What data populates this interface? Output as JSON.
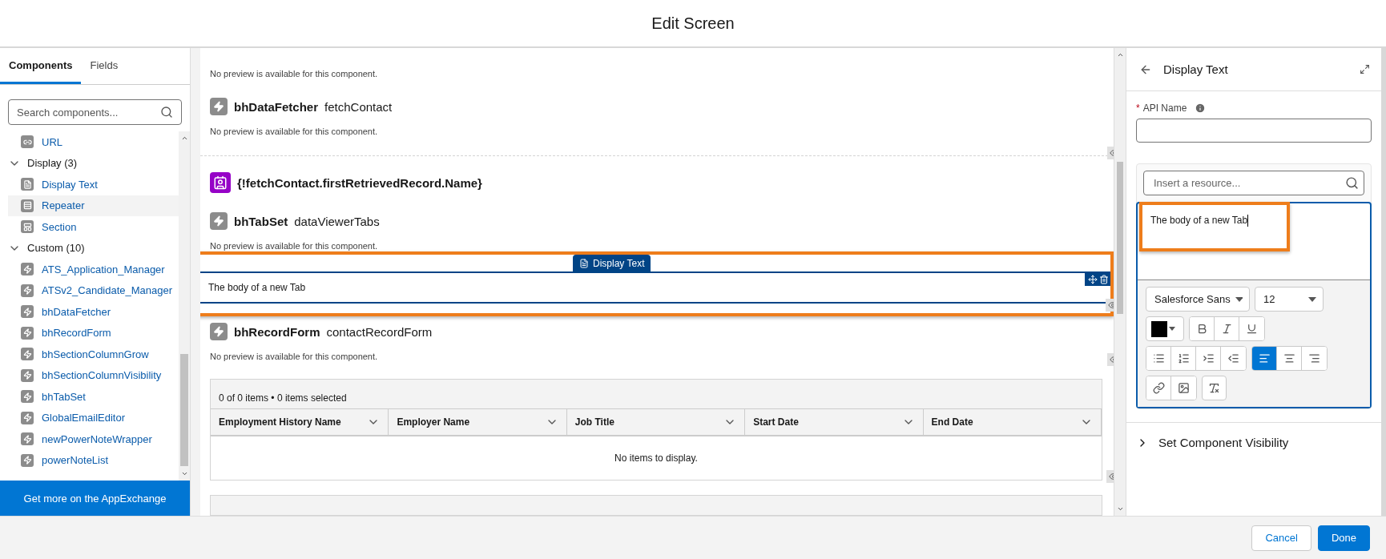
{
  "dialog": {
    "title": "Edit Screen"
  },
  "left_panel": {
    "tabs": [
      {
        "label": "Components",
        "selected": true
      },
      {
        "label": "Fields",
        "selected": false
      }
    ],
    "search": {
      "placeholder": "Search components..."
    },
    "items": [
      {
        "kind": "link",
        "label": "URL",
        "selected": false
      },
      {
        "kind": "group",
        "label": "Display (3)",
        "expanded": true,
        "children": [
          {
            "kind": "text",
            "label": "Display Text",
            "selected": false
          },
          {
            "kind": "repeater",
            "label": "Repeater",
            "selected": true
          },
          {
            "kind": "section",
            "label": "Section",
            "selected": false
          }
        ]
      },
      {
        "kind": "group",
        "label": "Custom (10)",
        "expanded": true,
        "children": [
          {
            "kind": "apex",
            "label": "ATS_Application_Manager",
            "selected": false
          },
          {
            "kind": "apex",
            "label": "ATSv2_Candidate_Manager",
            "selected": false
          },
          {
            "kind": "apex",
            "label": "bhDataFetcher",
            "selected": false
          },
          {
            "kind": "apex",
            "label": "bhRecordForm",
            "selected": false
          },
          {
            "kind": "apex",
            "label": "bhSectionColumnGrow",
            "selected": false
          },
          {
            "kind": "apex",
            "label": "bhSectionColumnVisibility",
            "selected": false
          },
          {
            "kind": "apex",
            "label": "bhTabSet",
            "selected": false
          },
          {
            "kind": "apex",
            "label": "GlobalEmailEditor",
            "selected": false
          },
          {
            "kind": "apex",
            "label": "newPowerNoteWrapper",
            "selected": false
          },
          {
            "kind": "apex",
            "label": "powerNoteList",
            "selected": false
          }
        ]
      }
    ],
    "footer_link": "Get more on the AppExchange"
  },
  "canvas": {
    "components": [
      {
        "kind": "preview",
        "preview": "No preview is available for this component."
      },
      {
        "kind": "apex",
        "type": "bhDataFetcher",
        "name": "fetchContact",
        "preview": "No preview is available for this component.",
        "conditional": true
      },
      {
        "kind": "record",
        "text": "{!fetchContact.firstRetrievedRecord.Name}"
      },
      {
        "kind": "apex",
        "type": "bhTabSet",
        "name": "dataViewerTabs",
        "preview": "No preview is available for this component.",
        "conditional": false
      },
      {
        "kind": "display_text",
        "tag": "Display Text",
        "text": "The body of a new Tab",
        "selected": true,
        "highlighted": true,
        "conditional": true
      },
      {
        "kind": "apex",
        "type": "bhRecordForm",
        "name": "contactRecordForm",
        "preview": "No preview is available for this component.",
        "conditional": true
      },
      {
        "kind": "table",
        "summary": "0 of 0 items • 0 items selected",
        "columns": [
          "Employment History Name",
          "Employer Name",
          "Job Title",
          "Start Date",
          "End Date"
        ],
        "empty": "No items to display.",
        "conditional": true
      },
      {
        "kind": "box"
      }
    ]
  },
  "properties": {
    "title": "Display Text",
    "api_name": {
      "label": "API Name",
      "required": true,
      "required_mark": "*"
    },
    "resource_search": {
      "placeholder": "Insert a resource..."
    },
    "editor": {
      "text": "The body of a new Tab",
      "highlighted": true,
      "font": "Salesforce Sans",
      "size": "12",
      "color": "#000000",
      "toolbar": [
        [
          {
            "kind": "bold",
            "selected": false
          },
          {
            "kind": "italic",
            "selected": false
          },
          {
            "kind": "underline",
            "selected": false
          }
        ],
        [
          {
            "kind": "bullets",
            "selected": false
          },
          {
            "kind": "numbers",
            "selected": false
          },
          {
            "kind": "indent",
            "selected": false
          },
          {
            "kind": "outdent",
            "selected": false
          },
          {
            "kind": "align-left",
            "selected": true
          },
          {
            "kind": "align-center",
            "selected": false
          },
          {
            "kind": "align-right",
            "selected": false
          }
        ],
        [
          {
            "kind": "link",
            "selected": false
          },
          {
            "kind": "image",
            "selected": false
          },
          {
            "kind": "clear",
            "selected": false
          }
        ]
      ]
    },
    "visibility": {
      "label": "Set Component Visibility",
      "expanded": false
    }
  },
  "buttons": [
    {
      "label": "Cancel",
      "kind": "neutral"
    },
    {
      "label": "Done",
      "kind": "brand"
    }
  ]
}
